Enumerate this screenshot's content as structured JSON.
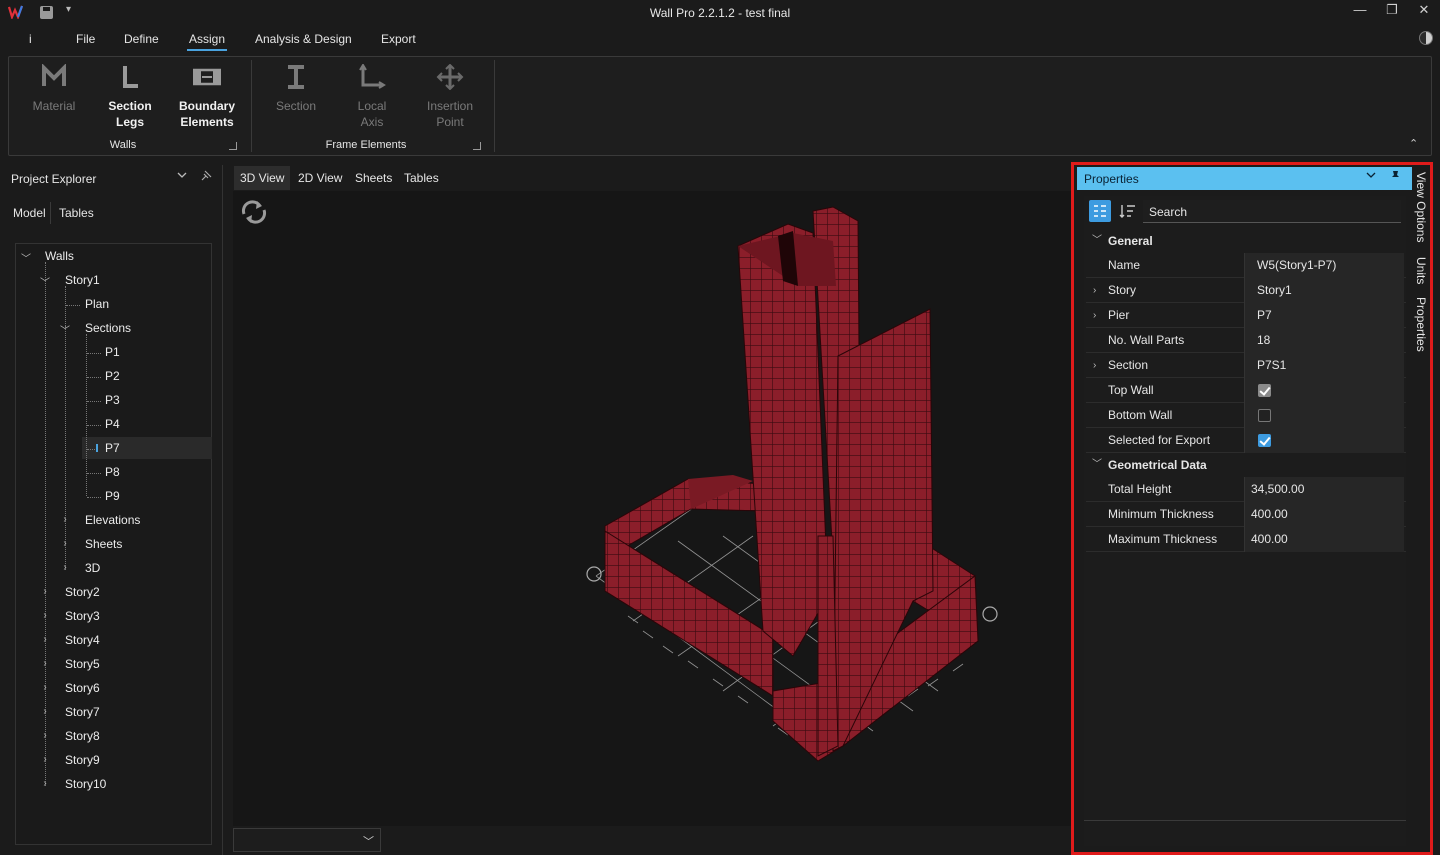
{
  "app": {
    "title": "Wall Pro 2.2.1.2 - test final",
    "qat_dropdown": "▾"
  },
  "window_controls": {
    "minimize": "—",
    "restore": "❐",
    "close": "✕"
  },
  "menu": {
    "info": "i",
    "items": [
      "File",
      "Define",
      "Assign",
      "Analysis & Design",
      "Export"
    ],
    "active": "Assign"
  },
  "ribbon": {
    "groups": [
      {
        "label": "Walls",
        "buttons": [
          {
            "line1": "Material",
            "line2": "",
            "enabled": false,
            "icon": "material-icon"
          },
          {
            "line1": "Section",
            "line2": "Legs",
            "enabled": true,
            "icon": "section-legs-icon"
          },
          {
            "line1": "Boundary",
            "line2": "Elements",
            "enabled": true,
            "icon": "boundary-elements-icon"
          }
        ]
      },
      {
        "label": "Frame Elements",
        "buttons": [
          {
            "line1": "Section",
            "line2": "",
            "enabled": false,
            "icon": "frame-section-icon"
          },
          {
            "line1": "Local",
            "line2": "Axis",
            "enabled": false,
            "icon": "local-axis-icon"
          },
          {
            "line1": "Insertion",
            "line2": "Point",
            "enabled": false,
            "icon": "insertion-point-icon"
          }
        ]
      }
    ],
    "collapse": "⌃"
  },
  "project_explorer": {
    "title": "Project Explorer",
    "tabs": [
      "Model",
      "Tables"
    ],
    "active_tab": "Model",
    "tree": {
      "root": "Walls",
      "story1": "Story1",
      "plan": "Plan",
      "sections": "Sections",
      "section_items": [
        "P1",
        "P2",
        "P3",
        "P4",
        "P7",
        "P8",
        "P9"
      ],
      "selected": "P7",
      "elevations": "Elevations",
      "sheets": "Sheets",
      "view3d": "3D",
      "other_stories": [
        "Story2",
        "Story3",
        "Story4",
        "Story5",
        "Story6",
        "Story7",
        "Story8",
        "Story9",
        "Story10"
      ]
    }
  },
  "view_tabs": [
    "3D View",
    "2D View",
    "Sheets",
    "Tables"
  ],
  "active_view_tab": "3D View",
  "properties": {
    "title": "Properties",
    "search_placeholder": "Search",
    "categories": {
      "general": "General",
      "geometrical": "Geometrical Data"
    },
    "general_rows": [
      {
        "name": "Name",
        "value": "W5(Story1-P7)",
        "expandable": false
      },
      {
        "name": "Story",
        "value": "Story1",
        "expandable": true
      },
      {
        "name": "Pier",
        "value": "P7",
        "expandable": true
      },
      {
        "name": "No. Wall Parts",
        "value": "18",
        "expandable": false
      },
      {
        "name": "Section",
        "value": "P7S1",
        "expandable": true
      }
    ],
    "checkbox_rows": [
      {
        "name": "Top Wall",
        "checked": true,
        "style": "gray"
      },
      {
        "name": "Bottom Wall",
        "checked": false,
        "style": "gray"
      },
      {
        "name": "Selected for Export",
        "checked": true,
        "style": "blue"
      }
    ],
    "geometry_rows": [
      {
        "name": "Total Height",
        "value": "34,500.00"
      },
      {
        "name": "Minimum Thickness",
        "value": "400.00"
      },
      {
        "name": "Maximum Thickness",
        "value": "400.00"
      }
    ]
  },
  "side_tabs": [
    "View Options",
    "Units",
    "Properties"
  ],
  "colors": {
    "accent": "#4aa3df",
    "properties_header": "#5bc0f0",
    "highlight_border": "#e01b1b",
    "wall_fill": "#8b1e2a",
    "wall_grid": "#3a0a10"
  }
}
